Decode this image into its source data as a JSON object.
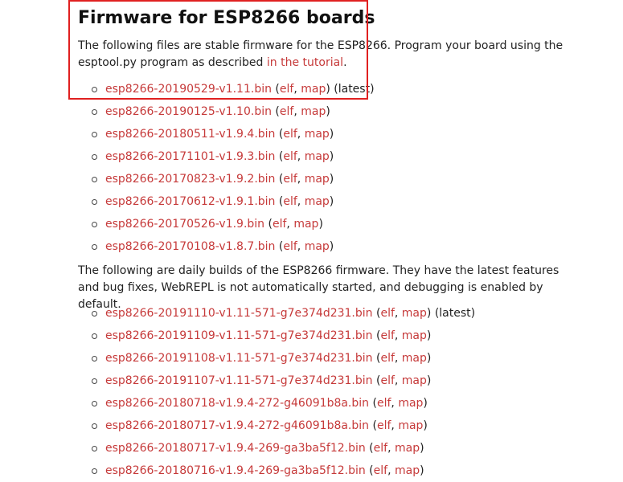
{
  "title": "Firmware for ESP8266 boards",
  "stable": {
    "intro_before": "The following files are stable firmware for the ESP8266. Program your board using the esptool.py program as described ",
    "intro_link": "in the tutorial",
    "intro_after": ".",
    "items": [
      {
        "file": "esp8266-20190529-v1.11.bin",
        "elf": "elf",
        "map": "map",
        "note": "(latest)"
      },
      {
        "file": "esp8266-20190125-v1.10.bin",
        "elf": "elf",
        "map": "map",
        "note": ""
      },
      {
        "file": "esp8266-20180511-v1.9.4.bin",
        "elf": "elf",
        "map": "map",
        "note": ""
      },
      {
        "file": "esp8266-20171101-v1.9.3.bin",
        "elf": "elf",
        "map": "map",
        "note": ""
      },
      {
        "file": "esp8266-20170823-v1.9.2.bin",
        "elf": "elf",
        "map": "map",
        "note": ""
      },
      {
        "file": "esp8266-20170612-v1.9.1.bin",
        "elf": "elf",
        "map": "map",
        "note": ""
      },
      {
        "file": "esp8266-20170526-v1.9.bin",
        "elf": "elf",
        "map": "map",
        "note": ""
      },
      {
        "file": "esp8266-20170108-v1.8.7.bin",
        "elf": "elf",
        "map": "map",
        "note": ""
      }
    ]
  },
  "daily": {
    "intro": "The following are daily builds of the ESP8266 firmware. They have the latest features and bug fixes, WebREPL is not automatically started, and debugging is enabled by default.",
    "items": [
      {
        "file": "esp8266-20191110-v1.11-571-g7e374d231.bin",
        "elf": "elf",
        "map": "map",
        "note": "(latest)"
      },
      {
        "file": "esp8266-20191109-v1.11-571-g7e374d231.bin",
        "elf": "elf",
        "map": "map",
        "note": ""
      },
      {
        "file": "esp8266-20191108-v1.11-571-g7e374d231.bin",
        "elf": "elf",
        "map": "map",
        "note": ""
      },
      {
        "file": "esp8266-20191107-v1.11-571-g7e374d231.bin",
        "elf": "elf",
        "map": "map",
        "note": ""
      },
      {
        "file": "esp8266-20180718-v1.9.4-272-g46091b8a.bin",
        "elf": "elf",
        "map": "map",
        "note": ""
      },
      {
        "file": "esp8266-20180717-v1.9.4-272-g46091b8a.bin",
        "elf": "elf",
        "map": "map",
        "note": ""
      },
      {
        "file": "esp8266-20180717-v1.9.4-269-ga3ba5f12.bin",
        "elf": "elf",
        "map": "map",
        "note": ""
      },
      {
        "file": "esp8266-20180716-v1.9.4-269-ga3ba5f12.bin",
        "elf": "elf",
        "map": "map",
        "note": ""
      }
    ]
  },
  "colors": {
    "link": "#c63a3a",
    "highlight": "#e02020",
    "text": "#222222"
  }
}
